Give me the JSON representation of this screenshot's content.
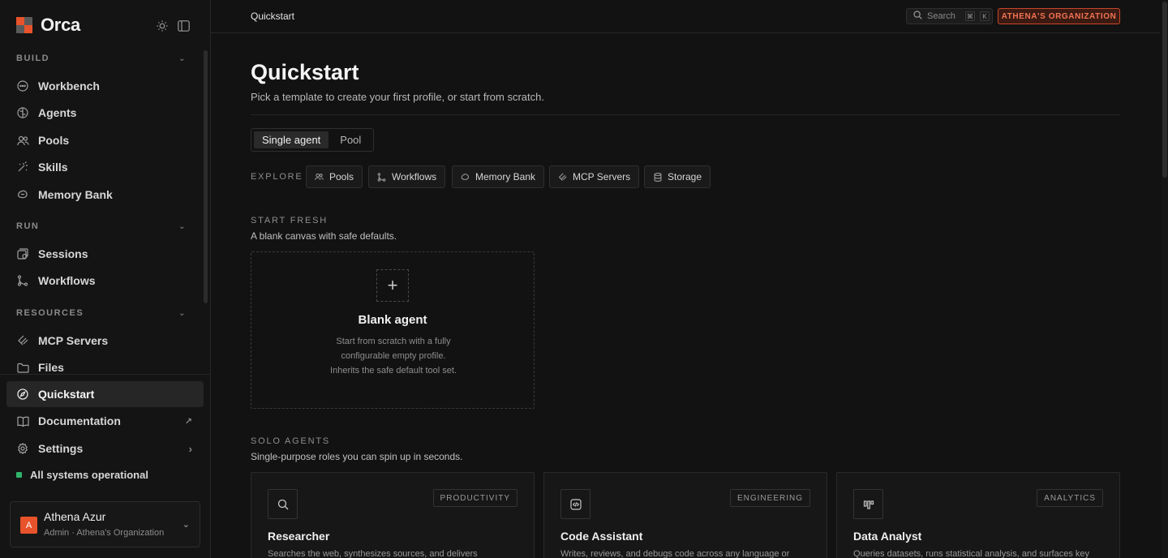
{
  "app": {
    "name": "Orca",
    "logo_colors": [
      "#e8532b",
      "#8a8a8a"
    ]
  },
  "sidebar": {
    "sections": [
      {
        "label": "BUILD"
      },
      {
        "label": "RUN"
      },
      {
        "label": "RESOURCES"
      }
    ],
    "build_items": [
      {
        "label": "Workbench",
        "icon": "chat-bubble-icon"
      },
      {
        "label": "Agents",
        "icon": "brain-icon"
      },
      {
        "label": "Pools",
        "icon": "users-icon"
      },
      {
        "label": "Skills",
        "icon": "wand-icon"
      },
      {
        "label": "Memory Bank",
        "icon": "memory-icon"
      }
    ],
    "run_items": [
      {
        "label": "Sessions",
        "icon": "session-icon"
      },
      {
        "label": "Workflows",
        "icon": "git-branch-icon"
      }
    ],
    "resource_items": [
      {
        "label": "MCP Servers",
        "icon": "plug-icon"
      },
      {
        "label": "Files",
        "icon": "folder-icon"
      }
    ],
    "bottom_items": [
      {
        "label": "Quickstart",
        "icon": "compass-icon",
        "active": true
      },
      {
        "label": "Documentation",
        "icon": "book-icon"
      },
      {
        "label": "Settings",
        "icon": "gear-icon"
      }
    ],
    "status": {
      "label": "All systems operational",
      "color": "#2fb36a"
    },
    "user": {
      "initial": "A",
      "name": "Athena Azur",
      "subtitle": "Admin · Athena's Organization",
      "avatar_color": "#e8532b"
    }
  },
  "topbar": {
    "breadcrumb": "Quickstart",
    "search_label": "Search",
    "shortcut_keys": [
      "⌘",
      "K"
    ],
    "org_label": "ATHENA'S ORGANIZATION",
    "org_color": "#ef7453"
  },
  "main": {
    "title": "Quickstart",
    "subtitle": "Pick a template to create your first profile, or start from scratch.",
    "mode_tabs": [
      {
        "label": "Single agent",
        "selected": true
      },
      {
        "label": "Pool",
        "selected": false
      }
    ],
    "explore_label": "EXPLORE",
    "explore_chips": [
      {
        "label": "Pools",
        "icon": "users-icon"
      },
      {
        "label": "Workflows",
        "icon": "git-branch-icon"
      },
      {
        "label": "Memory Bank",
        "icon": "memory-icon"
      },
      {
        "label": "MCP Servers",
        "icon": "plug-icon"
      },
      {
        "label": "Storage",
        "icon": "database-icon"
      }
    ],
    "start_fresh": {
      "label": "START FRESH",
      "subtitle": "A blank canvas with safe defaults.",
      "card_title": "Blank agent",
      "card_desc": "Start from scratch with a fully configurable empty profile. Inherits the safe default tool set."
    },
    "solo_agents": {
      "label": "SOLO AGENTS",
      "subtitle": "Single-purpose roles you can spin up in seconds.",
      "cards": [
        {
          "name": "Researcher",
          "tag": "PRODUCTIVITY",
          "icon": "search-icon",
          "desc": "Searches the web, synthesizes sources, and delivers"
        },
        {
          "name": "Code Assistant",
          "tag": "ENGINEERING",
          "icon": "code-icon",
          "desc": "Writes, reviews, and debugs code across any language or"
        },
        {
          "name": "Data Analyst",
          "tag": "ANALYTICS",
          "icon": "bar-chart-icon",
          "desc": "Queries datasets, runs statistical analysis, and surfaces key"
        }
      ]
    }
  }
}
